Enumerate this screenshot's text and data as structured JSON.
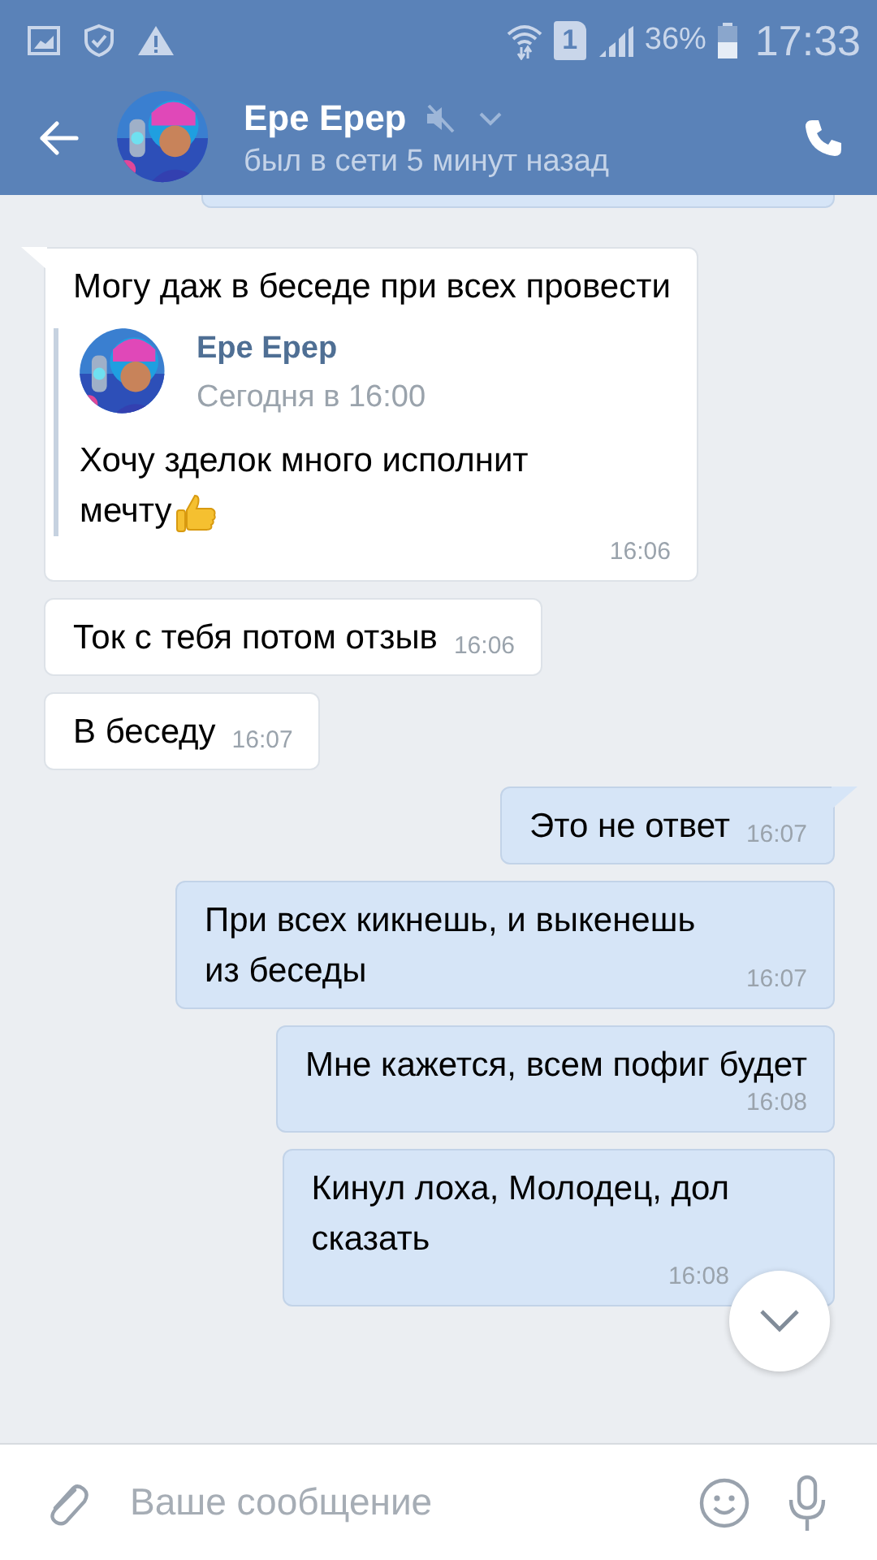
{
  "status_bar": {
    "sim": "1",
    "battery_text": "36%",
    "time": "17:33"
  },
  "header": {
    "name": "Ере Ерер",
    "muted": true,
    "status": "был в сети 5 минут назад"
  },
  "messages": [
    {
      "kind": "clipped",
      "outgoing": true
    },
    {
      "kind": "text",
      "outgoing": false,
      "tail": true,
      "text": "Могу даж в беседе при всех провести",
      "time": "16:06",
      "forward": {
        "name": "Ере Ерер",
        "date": "Сегодня в 16:00",
        "lines": [
          "Хочу зделок много исполнит",
          "мечту"
        ],
        "thumbs_up": true
      }
    },
    {
      "kind": "text",
      "outgoing": false,
      "tail": false,
      "text": "Ток с тебя потом отзыв",
      "time": "16:06"
    },
    {
      "kind": "text",
      "outgoing": false,
      "tail": false,
      "text": "В беседу",
      "time": "16:07"
    },
    {
      "kind": "text",
      "outgoing": true,
      "tail": true,
      "text": "Это не ответ",
      "time": "16:07"
    },
    {
      "kind": "text",
      "outgoing": true,
      "tail": false,
      "text": "При всех кикнешь, и выкенешь из беседы",
      "time": "16:07"
    },
    {
      "kind": "text",
      "outgoing": true,
      "tail": false,
      "text": "Мне кажется, всем пофиг будет",
      "time": "16:08",
      "block_time": true
    },
    {
      "kind": "text",
      "outgoing": true,
      "tail": false,
      "text": "Кинул лоха, Молодец, дол\nсказать",
      "time": "16:08",
      "block_time": true
    }
  ],
  "composer": {
    "placeholder": "Ваше сообщение"
  }
}
